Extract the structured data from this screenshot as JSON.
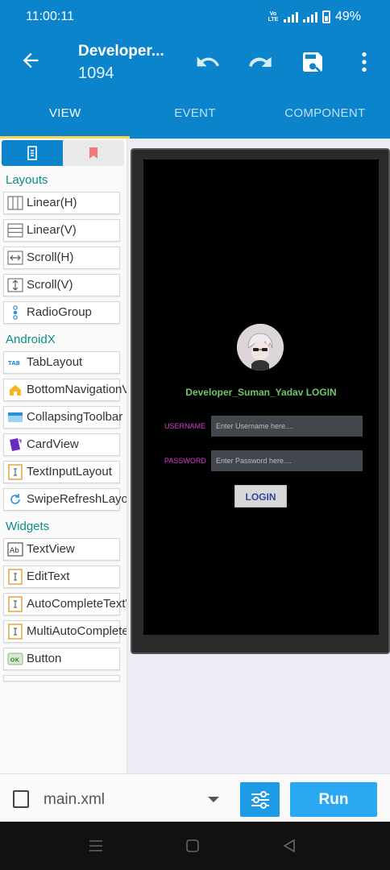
{
  "status_bar": {
    "time": "11:00:11",
    "battery": "49%"
  },
  "app_bar": {
    "title": "Developer...",
    "subtitle": "1094"
  },
  "tabs": [
    {
      "label": "VIEW",
      "active": true
    },
    {
      "label": "EVENT",
      "active": false
    },
    {
      "label": "COMPONENT",
      "active": false
    }
  ],
  "palette": {
    "sections": {
      "layouts": "Layouts",
      "androidx": "AndroidX",
      "widgets": "Widgets"
    },
    "layouts": [
      {
        "label": "Linear(H)",
        "icon": "linear-horizontal-icon"
      },
      {
        "label": "Linear(V)",
        "icon": "linear-vertical-icon"
      },
      {
        "label": "Scroll(H)",
        "icon": "scroll-horizontal-icon"
      },
      {
        "label": "Scroll(V)",
        "icon": "scroll-vertical-icon"
      },
      {
        "label": "RadioGroup",
        "icon": "radio-group-icon"
      }
    ],
    "androidx": [
      {
        "label": "TabLayout",
        "icon": "tab-icon"
      },
      {
        "label": "BottomNavigationView",
        "icon": "home-icon"
      },
      {
        "label": "CollapsingToolbar",
        "icon": "toolbar-icon"
      },
      {
        "label": "CardView",
        "icon": "card-icon"
      },
      {
        "label": "TextInputLayout",
        "icon": "text-input-icon"
      },
      {
        "label": "SwipeRefreshLayout",
        "icon": "refresh-icon"
      }
    ],
    "widgets": [
      {
        "label": "TextView",
        "icon": "textview-icon"
      },
      {
        "label": "EditText",
        "icon": "edittext-icon"
      },
      {
        "label": "AutoCompleteTextView",
        "icon": "autocomplete-icon"
      },
      {
        "label": "MultiAutoCompleteTextView",
        "icon": "multiautocomplete-icon"
      },
      {
        "label": "Button",
        "icon": "button-icon"
      }
    ]
  },
  "preview": {
    "login_title": "Developer_Suman_Yadav LOGIN",
    "username_label": "USERNAME",
    "username_placeholder": "Enter Username here....",
    "password_label": "PASSWORD",
    "password_placeholder": "Enter Password here....",
    "login_button": "LOGIN",
    "title_color": "#6ec86b",
    "label_color": "#d63cd6"
  },
  "bottom_bar": {
    "file": "main.xml",
    "run": "Run"
  },
  "colors": {
    "primary": "#0b84cc",
    "accent": "#ffd54f",
    "run": "#2aa9f2"
  }
}
